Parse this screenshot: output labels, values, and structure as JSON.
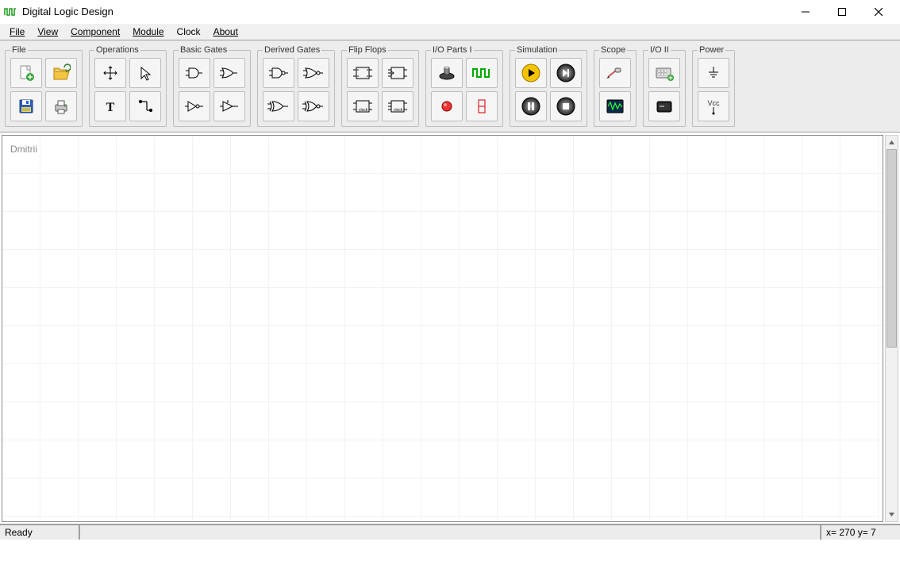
{
  "app": {
    "title": "Digital Logic Design"
  },
  "menu": {
    "file": "File",
    "view": "View",
    "component": "Component",
    "module": "Module",
    "clock": "Clock",
    "about": "About"
  },
  "groups": {
    "file": "File",
    "operations": "Operations",
    "basic_gates": "Basic Gates",
    "derived_gates": "Derived Gates",
    "flip_flops": "Flip Flops",
    "io1": "I/O Parts I",
    "simulation": "Simulation",
    "scope": "Scope",
    "io2": "I/O II",
    "power": "Power"
  },
  "power": {
    "vcc_label": "Vcc"
  },
  "canvas": {
    "label": "Dmitrii"
  },
  "status": {
    "ready": "Ready",
    "coords": "x= 270   y= 7"
  }
}
